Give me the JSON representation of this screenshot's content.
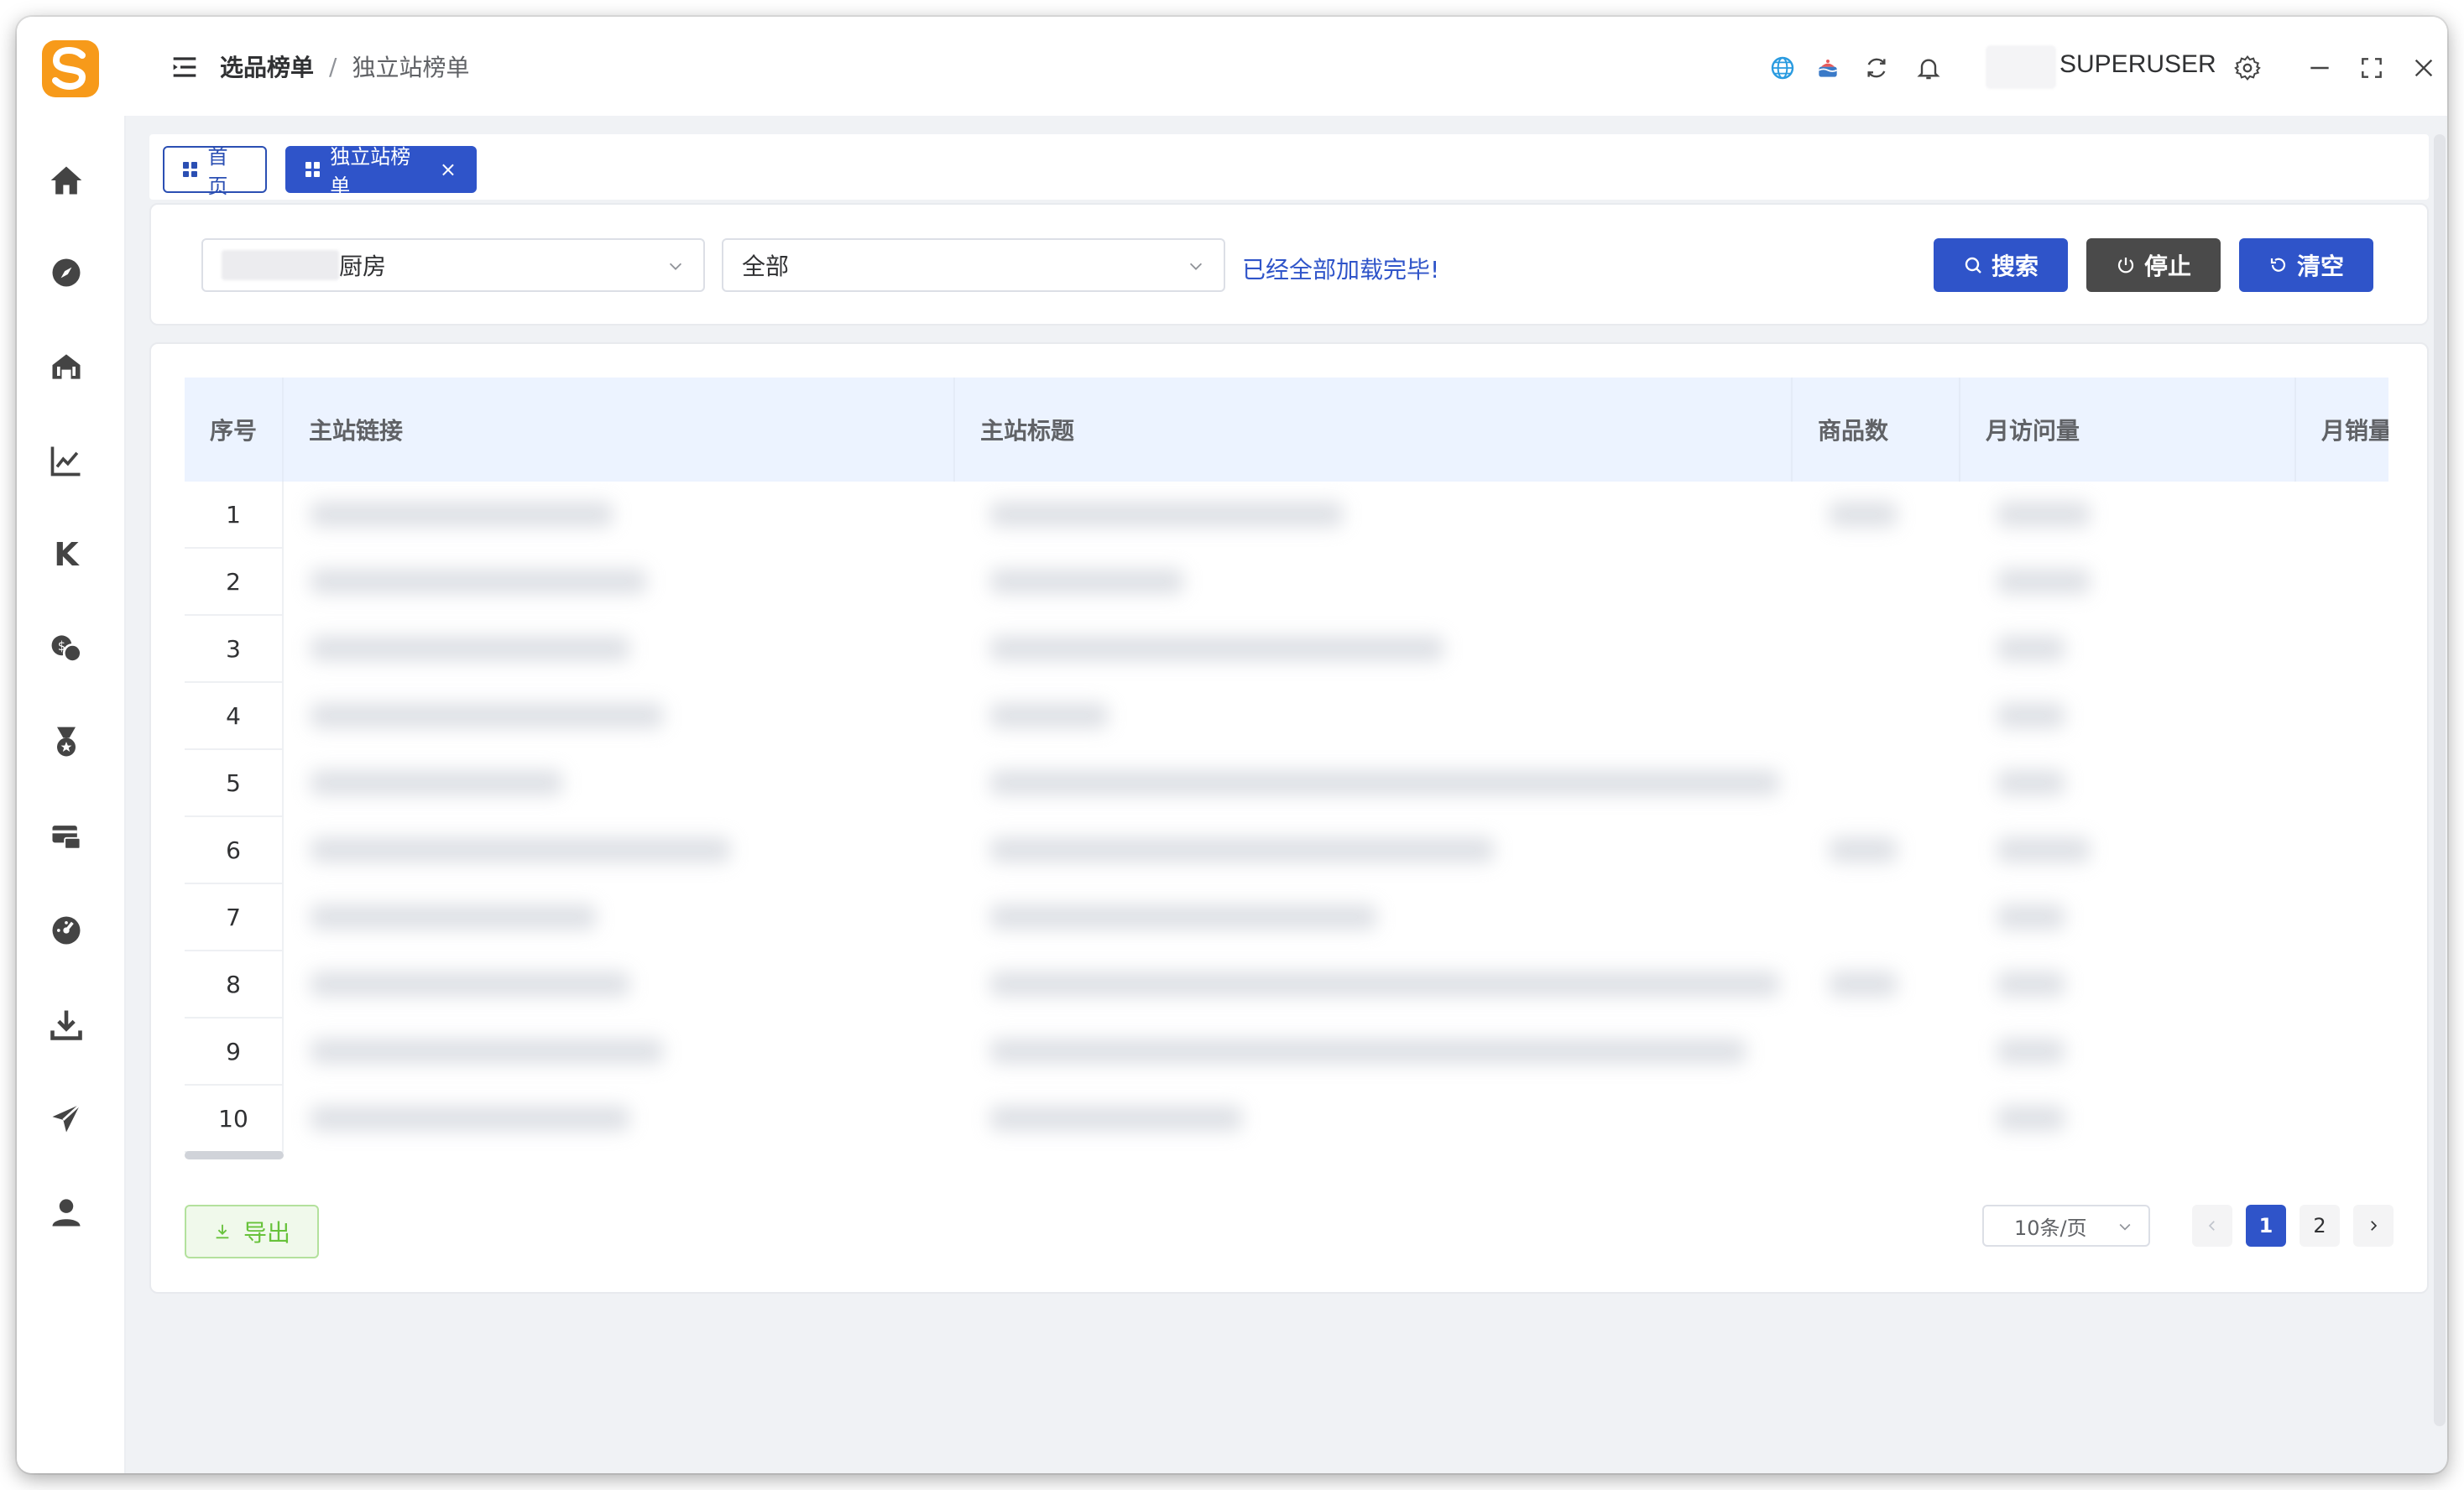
{
  "breadcrumb": {
    "parent": "选品榜单",
    "separator": "/",
    "current": "独立站榜单"
  },
  "header": {
    "username": "SUPERUSER"
  },
  "tabs": [
    {
      "label": "首页"
    },
    {
      "label": "独立站榜单"
    }
  ],
  "filters": {
    "category_value": "厨房",
    "scope_value": "全部",
    "status_message": "已经全部加载完毕!"
  },
  "buttons": {
    "search": "搜索",
    "stop": "停止",
    "clear": "清空",
    "export": "导出"
  },
  "table": {
    "columns": [
      "序号",
      "主站链接",
      "主站标题",
      "商品数",
      "月访问量",
      "月销量"
    ],
    "rows": [
      "1",
      "2",
      "3",
      "4",
      "5",
      "6",
      "7",
      "8",
      "9",
      "10"
    ]
  },
  "pagination": {
    "page_size": "10条/页",
    "pages": [
      "1",
      "2"
    ],
    "current_page": "1"
  },
  "colors": {
    "primary": "#2f54c9",
    "stop": "#4a4a4a",
    "export_green": "#67c23a",
    "logo_orange": "#f79a1a"
  }
}
